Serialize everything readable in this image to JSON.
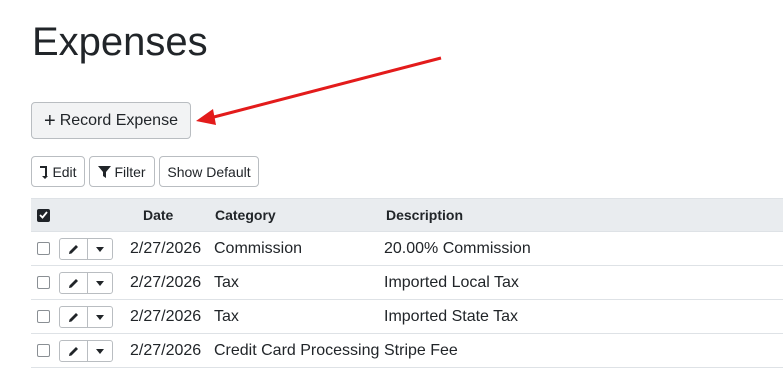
{
  "page": {
    "title": "Expenses"
  },
  "toolbar": {
    "record_label": "Record Expense",
    "edit_label": "Edit",
    "filter_label": "Filter",
    "show_default_label": "Show Default"
  },
  "table": {
    "headers": {
      "date": "Date",
      "category": "Category",
      "description": "Description"
    },
    "rows": [
      {
        "date": "2/27/2026",
        "category": "Commission",
        "description": "20.00% Commission"
      },
      {
        "date": "2/27/2026",
        "category": "Tax",
        "description": "Imported Local Tax"
      },
      {
        "date": "2/27/2026",
        "category": "Tax",
        "description": "Imported State Tax"
      },
      {
        "date": "2/27/2026",
        "category": "Credit Card Processing",
        "description": "Stripe Fee"
      }
    ]
  },
  "annotation": {
    "arrow_color": "#e31b1b"
  }
}
